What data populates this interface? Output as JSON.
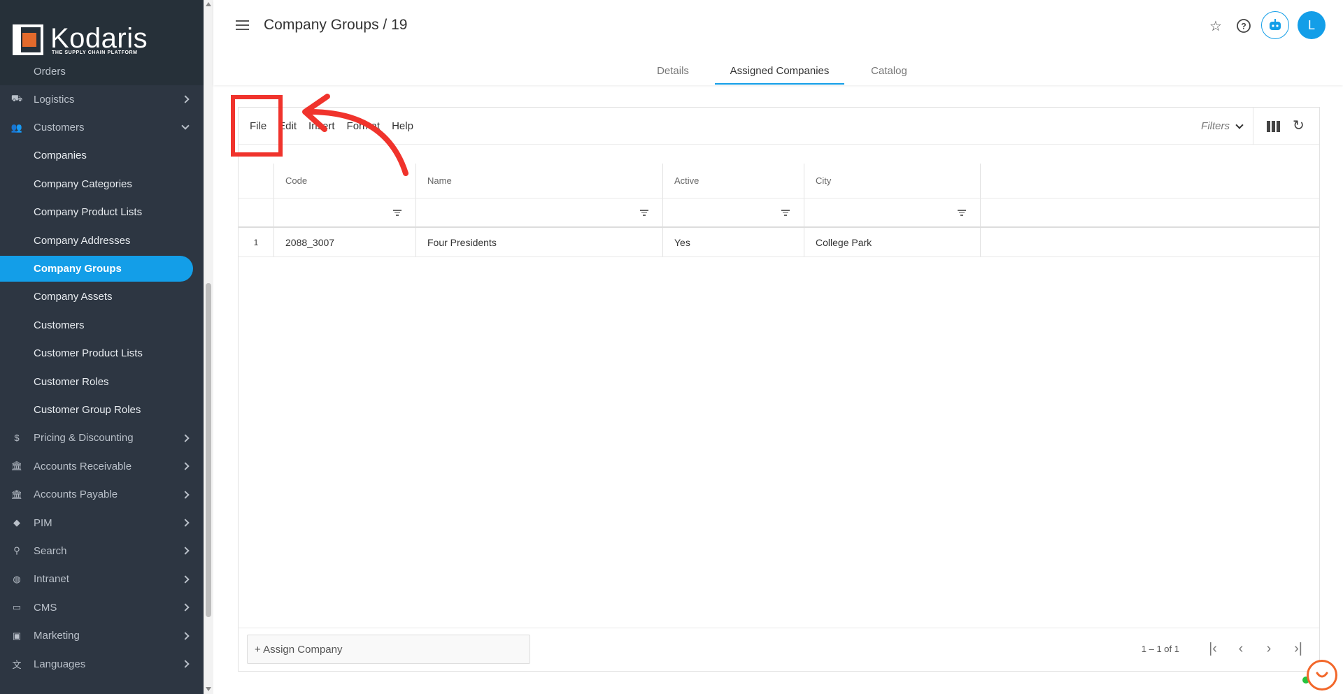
{
  "brand": {
    "name": "Kodaris",
    "tagline": "THE SUPPLY CHAIN PLATFORM",
    "accent": "#139ee8"
  },
  "sidebar": {
    "cut_item": "Orders",
    "items": [
      {
        "label": "Logistics",
        "icon": "truck-icon",
        "type": "section"
      },
      {
        "label": "Customers",
        "icon": "people-icon",
        "type": "section-open"
      },
      {
        "label": "Companies",
        "type": "sub"
      },
      {
        "label": "Company Categories",
        "type": "sub"
      },
      {
        "label": "Company Product Lists",
        "type": "sub"
      },
      {
        "label": "Company Addresses",
        "type": "sub"
      },
      {
        "label": "Company Groups",
        "type": "sub-active"
      },
      {
        "label": "Company Assets",
        "type": "sub"
      },
      {
        "label": "Customers",
        "type": "sub"
      },
      {
        "label": "Customer Product Lists",
        "type": "sub"
      },
      {
        "label": "Customer Roles",
        "type": "sub"
      },
      {
        "label": "Customer Group Roles",
        "type": "sub"
      },
      {
        "label": "Pricing & Discounting",
        "icon": "dollar-icon",
        "type": "section"
      },
      {
        "label": "Accounts Receivable",
        "icon": "bank-icon",
        "type": "section"
      },
      {
        "label": "Accounts Payable",
        "icon": "bank-icon",
        "type": "section"
      },
      {
        "label": "PIM",
        "icon": "tag-icon",
        "type": "section"
      },
      {
        "label": "Search",
        "icon": "search-icon",
        "type": "section"
      },
      {
        "label": "Intranet",
        "icon": "globe-icon",
        "type": "section"
      },
      {
        "label": "CMS",
        "icon": "cms-icon",
        "type": "section"
      },
      {
        "label": "Marketing",
        "icon": "megaphone-icon",
        "type": "section"
      },
      {
        "label": "Languages",
        "icon": "translate-icon",
        "type": "section"
      }
    ]
  },
  "header": {
    "title": "Company Groups / 19",
    "avatar_letter": "L",
    "tabs": [
      {
        "label": "Details"
      },
      {
        "label": "Assigned Companies"
      },
      {
        "label": "Catalog"
      }
    ]
  },
  "toolbar": {
    "menu": [
      "File",
      "Edit",
      "Insert",
      "Format",
      "Help"
    ],
    "filters_label": "Filters"
  },
  "grid": {
    "columns": [
      "Code",
      "Name",
      "Active",
      "City"
    ],
    "rows": [
      {
        "num": "1",
        "code": "2088_3007",
        "name": "Four Presidents",
        "active": "Yes",
        "city": "College Park"
      }
    ]
  },
  "footer": {
    "assign_label": "+ Assign Company",
    "pager": "1 – 1 of 1"
  },
  "annotation": {
    "color": "#f0332c"
  }
}
